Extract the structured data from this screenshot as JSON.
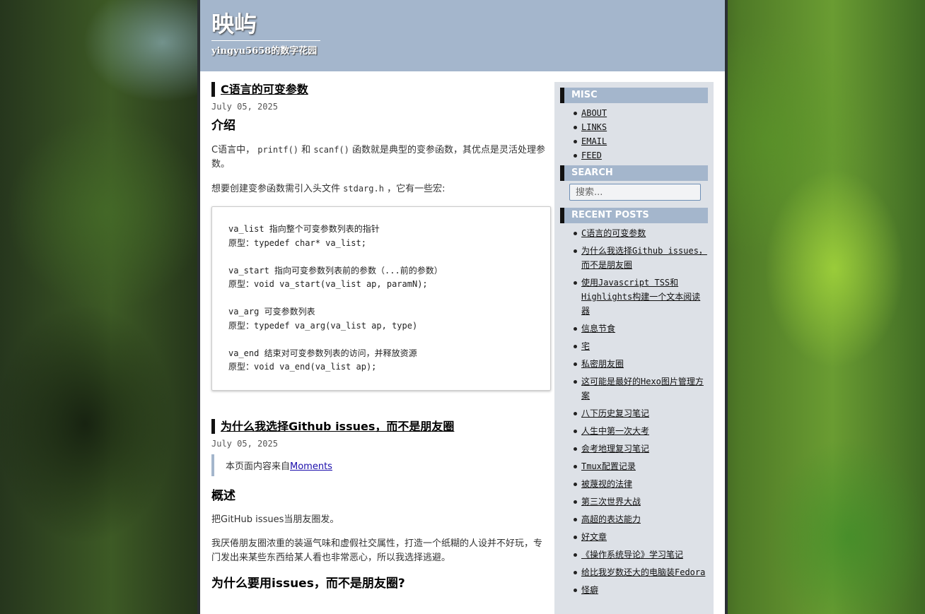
{
  "site": {
    "title": "映屿",
    "subtitle": "yingyu5658的数字花园"
  },
  "post1": {
    "title": "C语言的可变参数",
    "date": "July 05, 2025",
    "h_intro": "介绍",
    "para1_a": "C语言中，",
    "para1_code1": "printf()",
    "para1_b": "和",
    "para1_code2": "scanf()",
    "para1_c": "函数就是典型的变参函数，其优点是灵活处理参数。",
    "para2_a": "想要创建变参函数需引入头文件",
    "para2_code": "stdarg.h",
    "para2_b": "，它有一些宏:",
    "code_lines": [
      "va_list 指向整个可变参数列表的指针",
      "原型：typedef char* va_list;",
      "",
      "va_start 指向可变参数列表前的参数（...前的参数）",
      "原型：void va_start(va_list ap, paramN);",
      "",
      "va_arg 可变参数列表",
      "原型：typedef va_arg(va_list ap, type)",
      "",
      "va_end 结束对可变参数列表的访问，并释放资源",
      "原型：void va_end(va_list ap);"
    ]
  },
  "post2": {
    "title": "为什么我选择Github issues，而不是朋友圈",
    "date": "July 05, 2025",
    "quote_text": "本页面内容来自",
    "quote_link": "Moments",
    "h_overview": "概述",
    "para1": "把GitHub issues当朋友圈发。",
    "para2": "我厌倦朋友圈浓重的装逼气味和虚假社交属性，打造一个纸糊的人设并不好玩，专门发出来某些东西给某人看也非常恶心，所以我选择逃避。",
    "h_why": "为什么要用issues，而不是朋友圈?"
  },
  "sidebar": {
    "misc_title": "MISC",
    "misc_items": [
      "ABOUT",
      "LINKS",
      "EMAIL",
      "FEED"
    ],
    "search_title": "SEARCH",
    "search_placeholder": "搜索...",
    "recent_title": "RECENT POSTS",
    "recent_items": [
      "C语言的可变参数",
      "为什么我选择Github issues，而不是朋友圈",
      "使用Javascript TSS和Highlights构建一个文本阅读器",
      "信息节食",
      "宅",
      "私密朋友圈",
      "这可能是最好的Hexo图片管理方案",
      "八下历史复习笔记",
      "人生中第一次大考",
      "会考地理复习笔记",
      "Tmux配置记录",
      "被蔑视的法律",
      "第三次世界大战",
      "高超的表达能力",
      "好文章",
      "《操作系统导论》学习笔记",
      "给比我岁数还大的电脑装Fedora",
      "怪癖"
    ]
  }
}
